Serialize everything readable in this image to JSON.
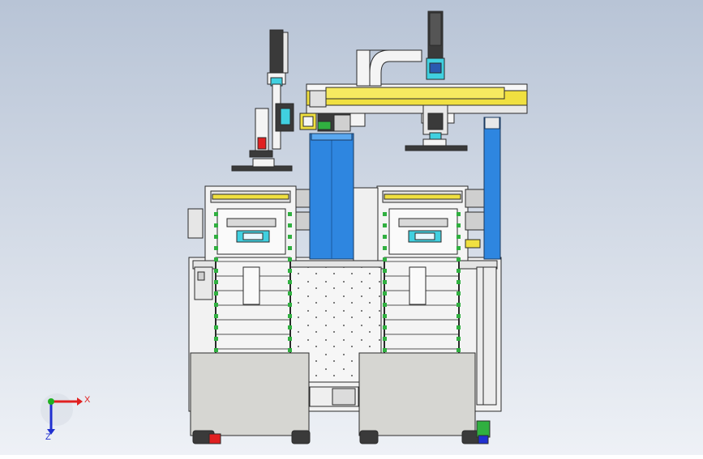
{
  "viewport": {
    "background_top": "#b8c4d6",
    "background_bottom": "#eef1f6"
  },
  "triad": {
    "x_label": "X",
    "z_label": "Z",
    "x_color": "#e02020",
    "y_color": "#20b020",
    "z_color": "#2030d0"
  },
  "colors": {
    "gantry_yellow": "#f0e040",
    "column_blue": "#2e86e0",
    "panel_grey": "#d6d6d2",
    "frame_white": "#f4f4f4",
    "motor_dark": "#3a3a3a",
    "cyan_parts": "#40d0e0",
    "green_parts": "#30b040",
    "line": "#2a2a2a"
  }
}
